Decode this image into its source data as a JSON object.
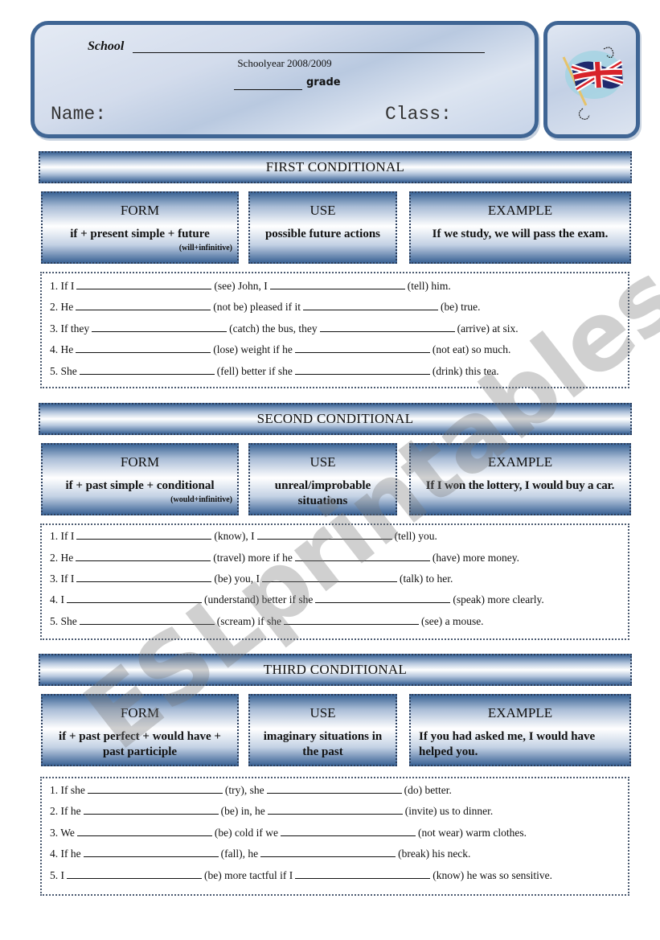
{
  "header": {
    "school_label": "School",
    "schoolyear": "Schoolyear 2008/2009",
    "grade_label": "grade",
    "name_label": "Name:",
    "class_label": "Class:",
    "flag_icon": "union-jack-flag-icon"
  },
  "sections": [
    {
      "title": "FIRST CONDITIONAL",
      "form": {
        "title": "FORM",
        "body": "if + present simple + future",
        "note": "(will+infinitive)"
      },
      "use": {
        "title": "USE",
        "body": "possible future actions"
      },
      "example": {
        "title": "EXAMPLE",
        "body": "If we study, we will pass the exam."
      },
      "exercises": [
        {
          "prefix": "1. If I",
          "verb1": "(see) John, I",
          "verb2": "(tell) him."
        },
        {
          "prefix": "2. He",
          "verb1": "(not be) pleased if it",
          "verb2": "(be) true."
        },
        {
          "prefix": "3. If they",
          "verb1": "(catch) the bus, they",
          "verb2": "(arrive) at six."
        },
        {
          "prefix": "4. He",
          "verb1": "(lose) weight if he",
          "verb2": "(not eat) so much."
        },
        {
          "prefix": "5. She",
          "verb1": "(fell) better if she",
          "verb2": "(drink) this tea."
        }
      ]
    },
    {
      "title": "SECOND CONDITIONAL",
      "form": {
        "title": "FORM",
        "body": "if + past simple + conditional",
        "note": "(would+infinitive)"
      },
      "use": {
        "title": "USE",
        "body": "unreal/improbable situations"
      },
      "example": {
        "title": "EXAMPLE",
        "body": "If I won the lottery, I would buy a car."
      },
      "exercises": [
        {
          "prefix": "1. If I",
          "verb1": "(know), I",
          "verb2": "(tell) you."
        },
        {
          "prefix": "2. He",
          "verb1": "(travel) more if he",
          "verb2": "(have) more money."
        },
        {
          "prefix": "3. If I",
          "verb1": "(be) you, I",
          "verb2": "(talk) to her."
        },
        {
          "prefix": "4. I",
          "verb1": "(understand) better if she",
          "verb2": "(speak) more clearly."
        },
        {
          "prefix": "5. She",
          "verb1": "(scream) if she",
          "verb2": "(see) a mouse."
        }
      ]
    },
    {
      "title": "THIRD CONDITIONAL",
      "form": {
        "title": "FORM",
        "body": "if + past perfect + would have + past participle",
        "note": ""
      },
      "use": {
        "title": "USE",
        "body": "imaginary situations in the past"
      },
      "example": {
        "title": "EXAMPLE",
        "body": "If you had asked me, I would have helped you."
      },
      "exercises": [
        {
          "prefix": "1. If she",
          "verb1": "(try), she",
          "verb2": "(do) better."
        },
        {
          "prefix": "2. If he",
          "verb1": "(be) in, he",
          "verb2": "(invite) us to dinner."
        },
        {
          "prefix": "3. We",
          "verb1": "(be) cold if we",
          "verb2": "(not wear) warm clothes."
        },
        {
          "prefix": "4. If he",
          "verb1": "(fall), he",
          "verb2": "(break) his neck."
        },
        {
          "prefix": "5. I",
          "verb1": "(be) more tactful if I",
          "verb2": "(know) he was so sensitive."
        }
      ]
    }
  ],
  "watermark": "ESLprintables.com"
}
